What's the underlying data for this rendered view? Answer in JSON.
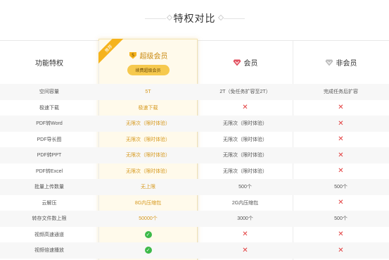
{
  "page": {
    "title": "特权对比"
  },
  "colors": {
    "gold": "#d6981c",
    "cross": "#e23b3b",
    "check": "#3cb949",
    "red_gem": "#e2505f",
    "grey_gem": "#bdbdbd"
  },
  "header": {
    "feature_col": "功能特权",
    "super": {
      "ribbon": "推荐",
      "title": "超级会员",
      "renew_button": "续费超级会员",
      "icon": "svip-shield-icon"
    },
    "vip": {
      "title": "会员",
      "icon": "red-gem-icon"
    },
    "free": {
      "title": "非会员",
      "icon": "grey-gem-icon"
    }
  },
  "rows": [
    {
      "feature": "空间容量",
      "super": "5T",
      "vip": "2T（免任务扩容至2T）",
      "free": "完成任务后扩容"
    },
    {
      "feature": "极速下载",
      "super": "极速下载",
      "vip": "✕",
      "free": "✕"
    },
    {
      "feature": "PDF转Word",
      "super": "无限次（限时体验）",
      "vip": "无限次（限时体验）",
      "free": "✕"
    },
    {
      "feature": "PDF导长图",
      "super": "无限次（限时体验）",
      "vip": "无限次（限时体验）",
      "free": "✕"
    },
    {
      "feature": "PDF转PPT",
      "super": "无限次（限时体验）",
      "vip": "无限次（限时体验）",
      "free": "✕"
    },
    {
      "feature": "PDF转Excel",
      "super": "无限次（限时体验）",
      "vip": "无限次（限时体验）",
      "free": "✕"
    },
    {
      "feature": "批量上传数量",
      "super": "无上限",
      "vip": "500个",
      "free": "500个"
    },
    {
      "feature": "云解压",
      "super": "8G内压缩包",
      "vip": "2G内压缩包",
      "free": "✕"
    },
    {
      "feature": "转存文件数上限",
      "super": "50000个",
      "vip": "3000个",
      "free": "500个"
    },
    {
      "feature": "视频高速通道",
      "super": "✓",
      "vip": "✕",
      "free": "✕"
    },
    {
      "feature": "视频倍速播放",
      "super": "✓",
      "vip": "✕",
      "free": "✕"
    }
  ]
}
